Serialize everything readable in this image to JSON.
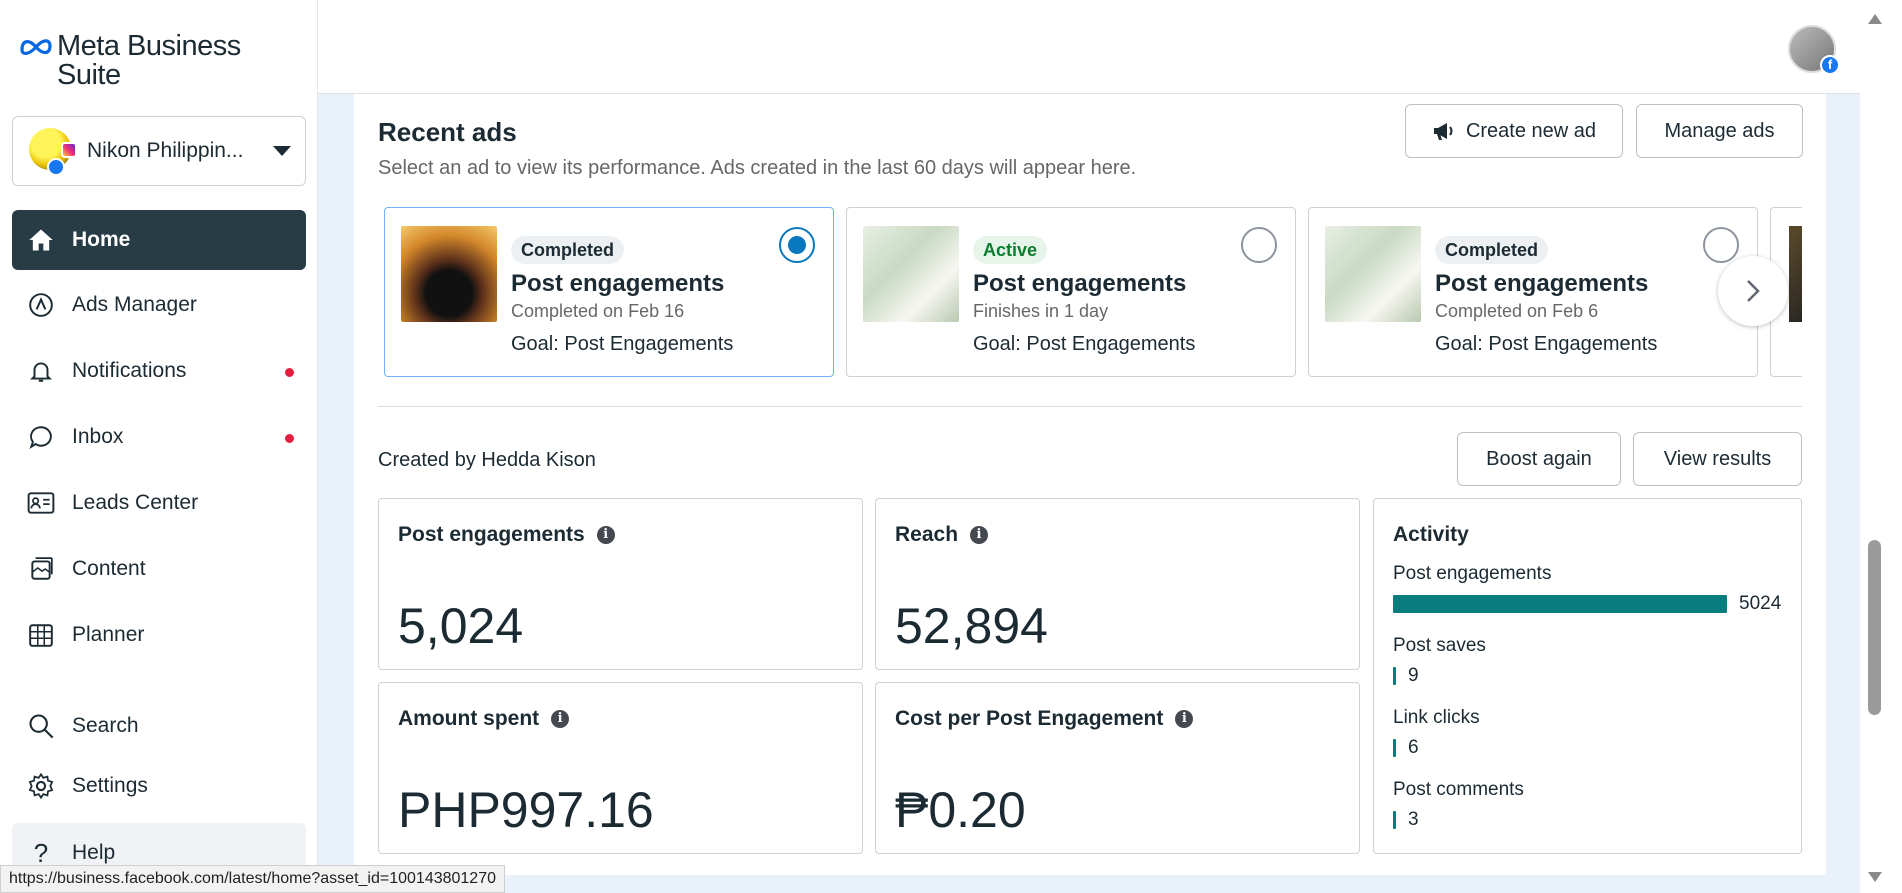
{
  "app": {
    "logo_text": "Meta Business Suite"
  },
  "account": {
    "name": "Nikon Philippin..."
  },
  "sidebar": {
    "items": [
      {
        "label": "Home",
        "icon": "home-icon"
      },
      {
        "label": "Ads Manager",
        "icon": "ads-manager-icon"
      },
      {
        "label": "Notifications",
        "icon": "bell-icon"
      },
      {
        "label": "Inbox",
        "icon": "chat-bubble-icon"
      },
      {
        "label": "Leads Center",
        "icon": "contact-card-icon"
      },
      {
        "label": "Content",
        "icon": "content-stack-icon"
      },
      {
        "label": "Planner",
        "icon": "calendar-grid-icon"
      },
      {
        "label": "Search",
        "icon": "search-icon"
      },
      {
        "label": "Settings",
        "icon": "gear-icon"
      },
      {
        "label": "Help",
        "icon": "question-icon"
      }
    ]
  },
  "recent_ads": {
    "title": "Recent ads",
    "subtitle": "Select an ad to view its performance. Ads created in the last 60 days will appear here.",
    "create_label": "Create new ad",
    "manage_label": "Manage ads",
    "ads": [
      {
        "status": "Completed",
        "title": "Post engagements",
        "date": "Completed on Feb 16",
        "goal": "Goal: Post Engagements",
        "selected": true
      },
      {
        "status": "Active",
        "title": "Post engagements",
        "date": "Finishes in 1 day",
        "goal": "Goal: Post Engagements",
        "selected": false
      },
      {
        "status": "Completed",
        "title": "Post engagements",
        "date": "Completed on Feb 6",
        "goal": "Goal: Post Engagements",
        "selected": false
      }
    ]
  },
  "details": {
    "creator": "Created by Hedda Kison",
    "boost_label": "Boost again",
    "view_label": "View results",
    "metrics": {
      "post_engagements": {
        "label": "Post engagements",
        "value": "5,024"
      },
      "reach": {
        "label": "Reach",
        "value": "52,894"
      },
      "amount_spent": {
        "label": "Amount spent",
        "value": "PHP997.16"
      },
      "cost_per": {
        "label": "Cost per Post Engagement",
        "value": "₱0.20"
      }
    },
    "activity": {
      "title": "Activity",
      "rows": [
        {
          "label": "Post engagements",
          "value": "5024",
          "fraction": 1.0
        },
        {
          "label": "Post saves",
          "value": "9",
          "fraction": 0.0018
        },
        {
          "label": "Link clicks",
          "value": "6",
          "fraction": 0.0012
        },
        {
          "label": "Post comments",
          "value": "3",
          "fraction": 0.0006
        }
      ]
    }
  },
  "status_url": "https://business.facebook.com/latest/home?asset_id=100143801270",
  "colors": {
    "nav_active": "#283c46",
    "activity_bar": "#077d7d",
    "selected_radio": "#0a78be",
    "notification_dot": "#e41e3f"
  }
}
